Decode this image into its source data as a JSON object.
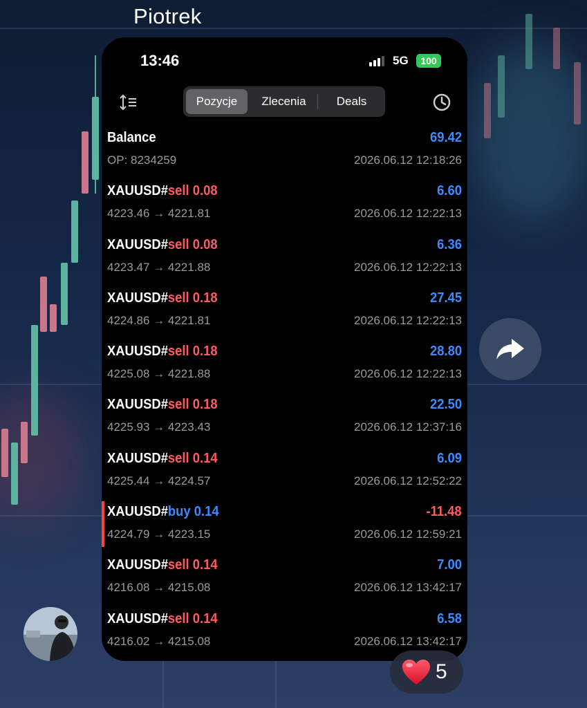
{
  "message": {
    "sender": "Piotrek"
  },
  "status_bar": {
    "time": "13:46",
    "network": "5G",
    "battery": "100"
  },
  "tabs": [
    {
      "label": "Pozycje",
      "active": true
    },
    {
      "label": "Zlecenia",
      "active": false
    },
    {
      "label": "Deals",
      "active": false
    }
  ],
  "icons": {
    "sort": "sort-icon",
    "history": "clock-icon",
    "share": "forward-arrow-icon",
    "reaction": "heart-icon"
  },
  "balance": {
    "label": "Balance",
    "amount": "69.42",
    "op": "OP: 8234259",
    "time": "2026.06.12 12:18:26"
  },
  "deals": [
    {
      "symbol": "XAUUSD#",
      "direction": "sell",
      "volume": "0.08",
      "profit": "6.60",
      "prices": "4223.46 → 4221.81",
      "time": "2026.06.12 12:22:13"
    },
    {
      "symbol": "XAUUSD#",
      "direction": "sell",
      "volume": "0.08",
      "profit": "6.36",
      "prices": "4223.47 → 4221.88",
      "time": "2026.06.12 12:22:13"
    },
    {
      "symbol": "XAUUSD#",
      "direction": "sell",
      "volume": "0.18",
      "profit": "27.45",
      "prices": "4224.86 → 4221.81",
      "time": "2026.06.12 12:22:13"
    },
    {
      "symbol": "XAUUSD#",
      "direction": "sell",
      "volume": "0.18",
      "profit": "28.80",
      "prices": "4225.08 → 4221.88",
      "time": "2026.06.12 12:22:13"
    },
    {
      "symbol": "XAUUSD#",
      "direction": "sell",
      "volume": "0.18",
      "profit": "22.50",
      "prices": "4225.93 → 4223.43",
      "time": "2026.06.12 12:37:16"
    },
    {
      "symbol": "XAUUSD#",
      "direction": "sell",
      "volume": "0.14",
      "profit": "6.09",
      "prices": "4225.44 → 4224.57",
      "time": "2026.06.12 12:52:22"
    },
    {
      "symbol": "XAUUSD#",
      "direction": "buy",
      "volume": "0.14",
      "profit": "-11.48",
      "prices": "4224.79 → 4223.15",
      "time": "2026.06.12 12:59:21"
    },
    {
      "symbol": "XAUUSD#",
      "direction": "sell",
      "volume": "0.14",
      "profit": "7.00",
      "prices": "4216.08 → 4215.08",
      "time": "2026.06.12 13:42:17"
    },
    {
      "symbol": "XAUUSD#",
      "direction": "sell",
      "volume": "0.14",
      "profit": "6.58",
      "prices": "4216.02 → 4215.08",
      "time": "2026.06.12 13:42:17"
    }
  ],
  "reaction": {
    "emoji": "❤️",
    "count": "5"
  },
  "colors": {
    "profit_positive": "#3d8bff",
    "profit_negative": "#ff5a5f",
    "sell": "#ff5a5f",
    "buy": "#3d8bff",
    "battery": "#34c759"
  }
}
